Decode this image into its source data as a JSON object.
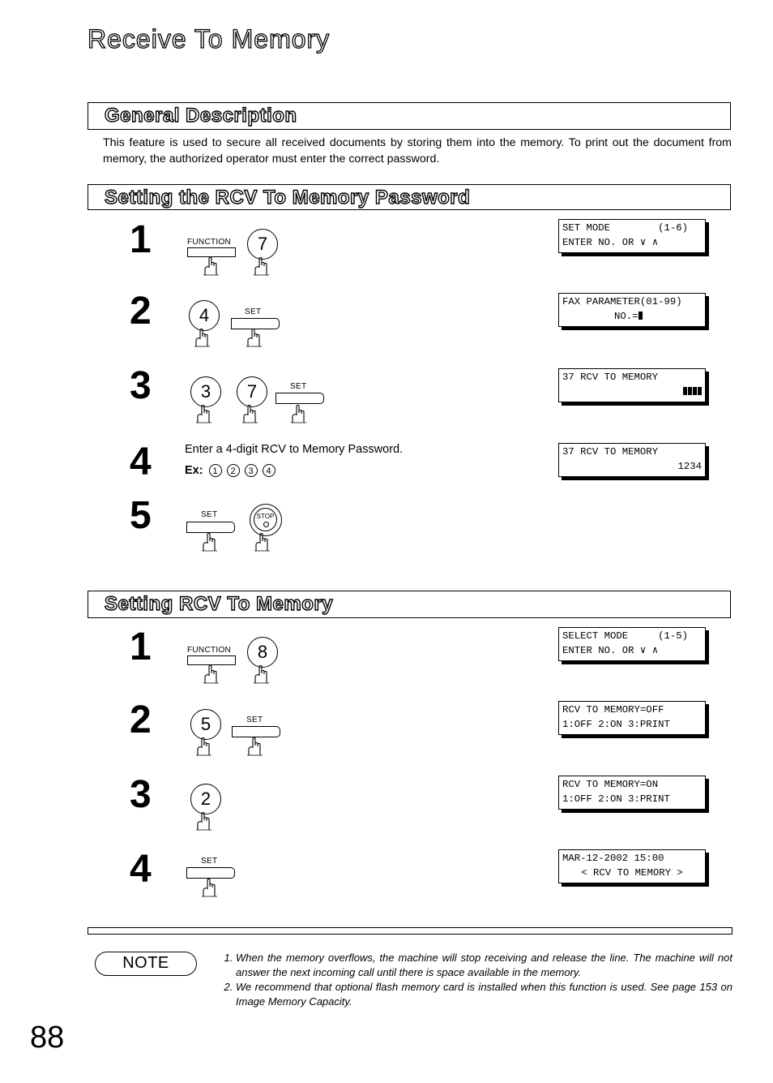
{
  "page": {
    "title": "Receive To Memory",
    "page_number": "88"
  },
  "general": {
    "heading": "General Description",
    "text": "This feature is used to secure all received documents by storing them into the memory.  To print out the document from memory, the authorized operator must enter the correct password."
  },
  "password_section": {
    "heading": "Setting the RCV To Memory Password",
    "steps": [
      {
        "num": "1",
        "keys": [
          "FUNCTION",
          "7"
        ],
        "lcd": [
          "SET MODE        (1-6)",
          "ENTER NO. OR ∨ ∧"
        ]
      },
      {
        "num": "2",
        "keys": [
          "4",
          "SET"
        ],
        "lcd": [
          "FAX PARAMETER(01-99)",
          "NO.="
        ]
      },
      {
        "num": "3",
        "keys": [
          "3",
          "7",
          "SET"
        ],
        "lcd": [
          "37 RCV TO MEMORY",
          ""
        ]
      },
      {
        "num": "4",
        "text": "Enter a 4-digit RCV to Memory Password.",
        "example_label": "Ex:",
        "example_digits": [
          "1",
          "2",
          "3",
          "4"
        ],
        "lcd": [
          "37 RCV TO MEMORY",
          "1234"
        ]
      },
      {
        "num": "5",
        "keys": [
          "SET",
          "STOP"
        ]
      }
    ]
  },
  "rcv_section": {
    "heading": "Setting RCV To Memory",
    "steps": [
      {
        "num": "1",
        "keys": [
          "FUNCTION",
          "8"
        ],
        "lcd": [
          "SELECT MODE     (1-5)",
          "ENTER NO. OR ∨ ∧"
        ]
      },
      {
        "num": "2",
        "keys": [
          "5",
          "SET"
        ],
        "lcd": [
          "RCV TO MEMORY=OFF",
          "1:OFF 2:ON 3:PRINT"
        ]
      },
      {
        "num": "3",
        "keys": [
          "2"
        ],
        "lcd": [
          "RCV TO MEMORY=ON",
          "1:OFF 2:ON 3:PRINT"
        ]
      },
      {
        "num": "4",
        "keys": [
          "SET"
        ],
        "lcd": [
          "MAR-12-2002 15:00",
          "< RCV TO MEMORY >"
        ]
      }
    ]
  },
  "note": {
    "label": "NOTE",
    "items": [
      "When the memory overflows, the machine will stop receiving and release the line.  The machine will not answer the next incoming call until there is space available in the memory.",
      "We recommend that optional flash memory card is installed when this function is used.  See page 153 on Image Memory Capacity."
    ]
  }
}
